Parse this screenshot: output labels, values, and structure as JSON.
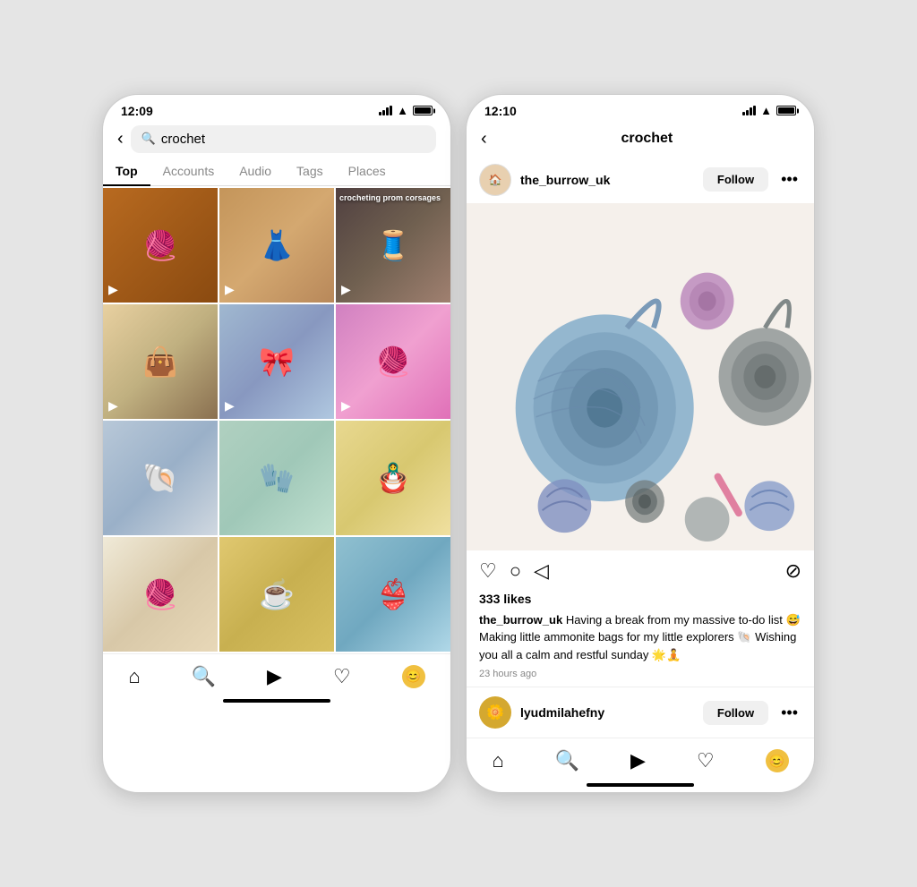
{
  "left_phone": {
    "time": "12:09",
    "search_placeholder": "crochet",
    "search_value": "crochet",
    "tabs": [
      "Top",
      "Accounts",
      "Audio",
      "Tags",
      "Places"
    ],
    "active_tab": "Top",
    "grid_items": [
      {
        "id": 1,
        "type": "video",
        "color_class": "img-crochet-1",
        "emoji": "🧶",
        "caption": ""
      },
      {
        "id": 2,
        "type": "video",
        "color_class": "img-crochet-2",
        "emoji": "👗",
        "caption": ""
      },
      {
        "id": 3,
        "type": "video",
        "color_class": "img-crochet-3",
        "emoji": "🧵",
        "caption": "crocheting prom corsages"
      },
      {
        "id": 4,
        "type": "video",
        "color_class": "img-crochet-4",
        "emoji": "👜",
        "caption": ""
      },
      {
        "id": 5,
        "type": "video",
        "color_class": "img-crochet-5",
        "emoji": "🎀",
        "caption": ""
      },
      {
        "id": 6,
        "type": "video",
        "color_class": "img-crochet-6",
        "emoji": "🧶",
        "caption": ""
      },
      {
        "id": 7,
        "type": "image",
        "color_class": "img-crochet-7",
        "emoji": "🐚",
        "caption": ""
      },
      {
        "id": 8,
        "type": "image",
        "color_class": "img-crochet-8",
        "emoji": "🧤",
        "caption": ""
      },
      {
        "id": 9,
        "type": "image",
        "color_class": "img-crochet-9",
        "emoji": "🪆",
        "caption": ""
      },
      {
        "id": 10,
        "type": "image",
        "color_class": "img-crochet-10",
        "emoji": "🧶",
        "caption": ""
      },
      {
        "id": 11,
        "type": "image",
        "color_class": "img-crochet-11",
        "emoji": "☕",
        "caption": ""
      },
      {
        "id": 12,
        "type": "image",
        "color_class": "img-crochet-12",
        "emoji": "👙",
        "caption": ""
      }
    ],
    "bottom_nav": [
      "home",
      "search",
      "reels",
      "heart",
      "avatar"
    ]
  },
  "right_phone": {
    "time": "12:10",
    "title": "crochet",
    "account": {
      "username": "the_burrow_uk",
      "follow_label": "Follow",
      "avatar_emoji": "🏠"
    },
    "post": {
      "likes": "333 likes",
      "caption_username": "the_burrow_uk",
      "caption_text": " Having a break from my massive to-do list 😅 Making little ammonite bags for my little explorers 🐚 Wishing you all a calm and restful sunday 🌟🧘",
      "time_ago": "23 hours ago"
    },
    "comment_account": {
      "username": "lyudmilahefny",
      "follow_label": "Follow",
      "avatar_emoji": "🌼"
    }
  }
}
